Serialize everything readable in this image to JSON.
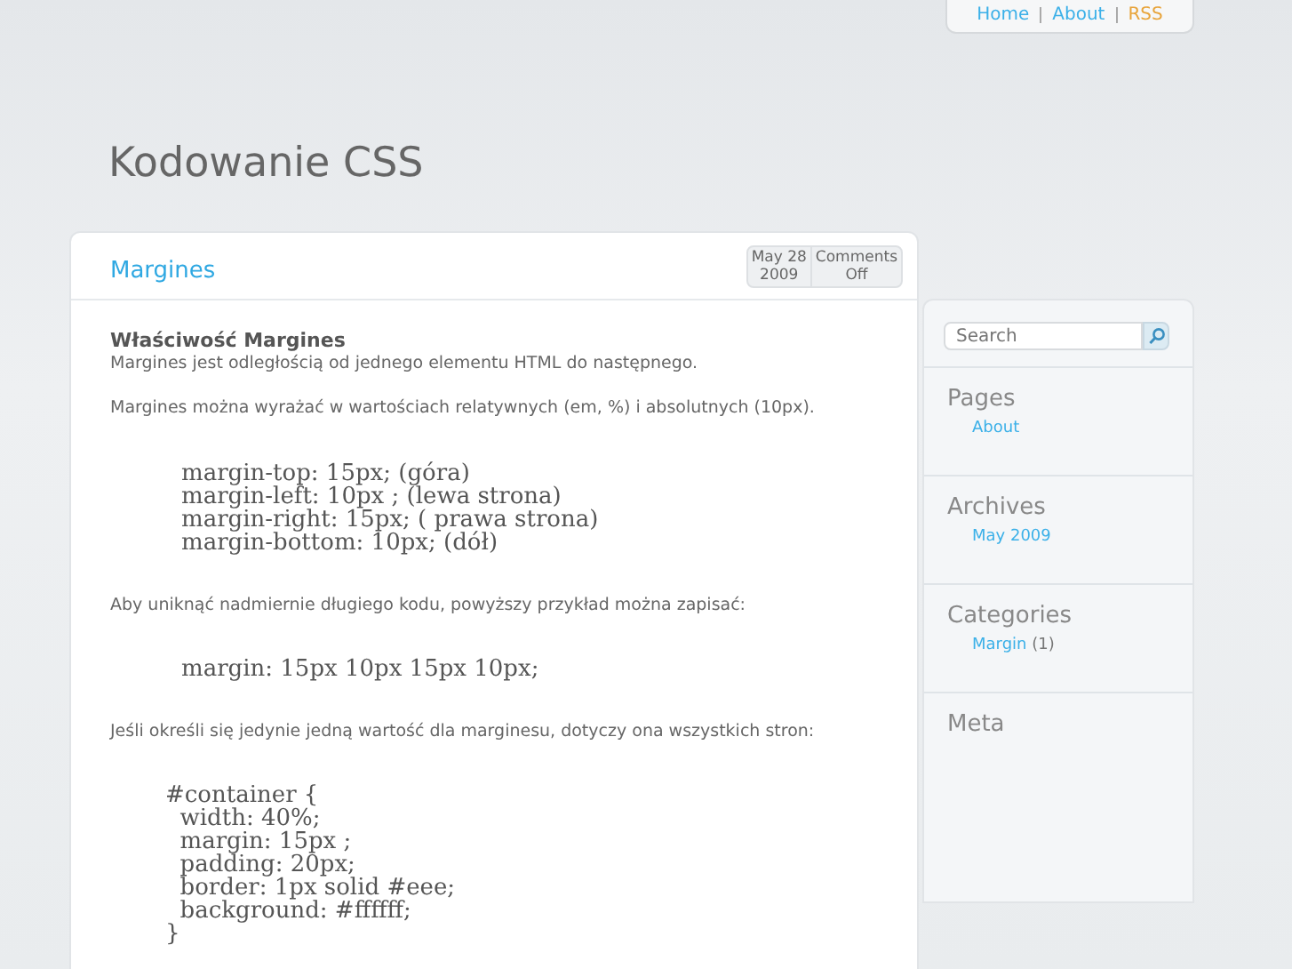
{
  "top_nav": [
    {
      "label": "Home",
      "kind": "page"
    },
    {
      "label": "About",
      "kind": "page"
    },
    {
      "label": "RSS",
      "kind": "feed"
    }
  ],
  "blog_title": "Kodowanie CSS",
  "post": {
    "title": "Margines",
    "date": {
      "day": "May 28",
      "year": "2009"
    },
    "comments": {
      "label": "Comments",
      "value": "Off"
    },
    "body": [
      {
        "kind": "heading",
        "text": "Właściwość Margines"
      },
      {
        "kind": "paragraph",
        "text": "Margines jest odległością od jednego elementu HTML do następnego."
      },
      {
        "kind": "paragraph",
        "text": "Margines można wyrażać w wartościach relatywnych (em, %) i absolutnych (10px)."
      },
      {
        "kind": "code",
        "lines": [
          "margin-top: 15px; (góra)",
          "margin-left: 10px ; (lewa strona)",
          "margin-right: 15px; ( prawa strona)",
          "margin-bottom: 10px; (dół)"
        ]
      },
      {
        "kind": "paragraph",
        "text": "Aby uniknąć nadmiernie długiego kodu, powyższy przykład można zapisać:"
      },
      {
        "kind": "code",
        "lines": [
          "margin: 15px 10px 15px 10px;"
        ]
      },
      {
        "kind": "paragraph",
        "text": "Jeśli określi się jedynie jedną wartość dla marginesu, dotyczy ona wszystkich stron:"
      },
      {
        "kind": "code_block",
        "lines": [
          "#container {",
          "  width: 40%;",
          "  margin: 15px ;",
          "  padding: 20px;",
          "  border: 1px solid #eee;",
          "  background: #ffffff;",
          "}"
        ]
      }
    ]
  },
  "sidebar": {
    "search": {
      "placeholder": "Search"
    },
    "widgets": [
      {
        "title": "Pages",
        "items": [
          {
            "label": "About"
          }
        ]
      },
      {
        "title": "Archives",
        "items": [
          {
            "label": "May 2009"
          }
        ]
      },
      {
        "title": "Categories",
        "items": [
          {
            "label": "Margin",
            "count": "(1)"
          }
        ]
      },
      {
        "title": "Meta"
      }
    ]
  }
}
